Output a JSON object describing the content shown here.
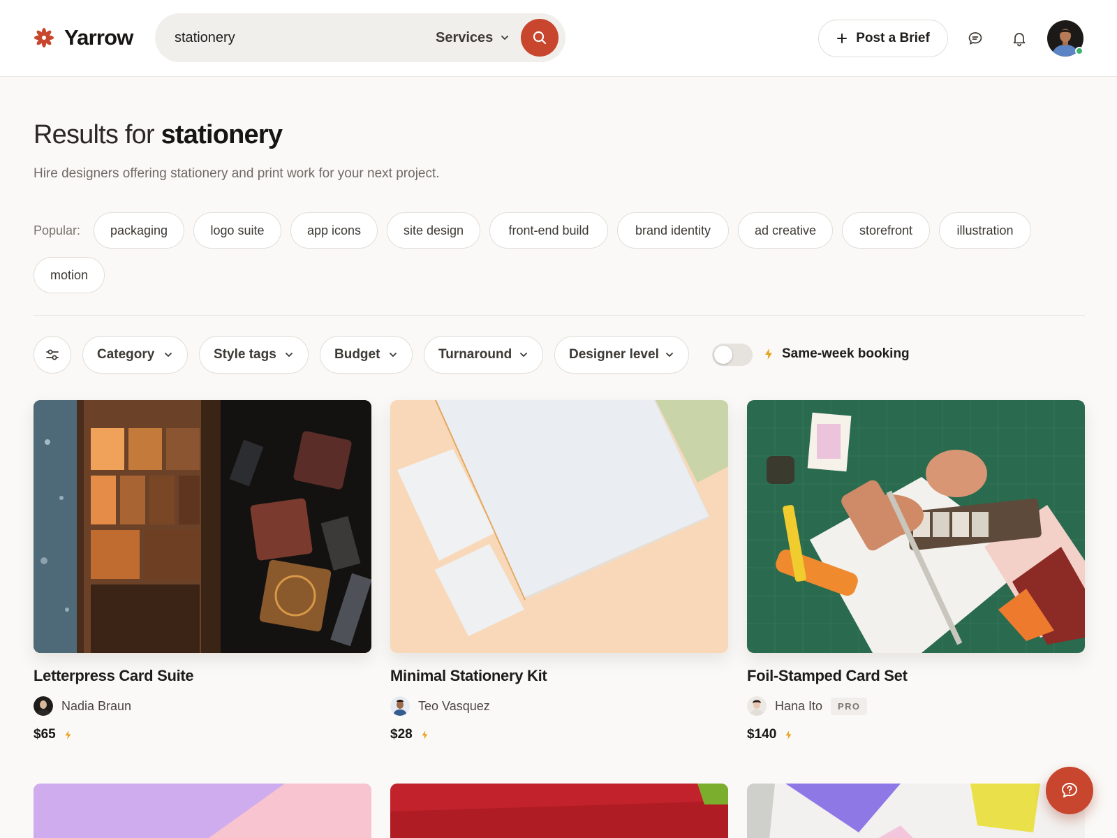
{
  "header": {
    "brand_name": "Yarrow",
    "search_value": "stationery",
    "search_scope": "Services",
    "post_brief_label": "Post a Brief",
    "icons": [
      "search-icon",
      "chat-icon",
      "bell-icon"
    ],
    "accent_color": "#c7462d"
  },
  "page": {
    "title_prefix": "Results for",
    "title_query": "stationery",
    "subtitle": "Hire designers offering stationery and print work for your next project."
  },
  "popular": {
    "label": "Popular:",
    "tags": [
      "packaging",
      "logo suite",
      "app icons",
      "site design",
      "front-end build",
      "brand identity",
      "ad creative",
      "storefront",
      "illustration",
      "motion"
    ]
  },
  "filters": {
    "items": [
      "Category",
      "Style tags",
      "Budget",
      "Turnaround",
      "Designer level"
    ],
    "same_week_label": "Same-week booking",
    "same_week_enabled": false
  },
  "cards": [
    {
      "title": "Letterpress Card Suite",
      "seller": "Nadia Braun",
      "price": "$65",
      "pro": false
    },
    {
      "title": "Minimal Stationery Kit",
      "seller": "Teo Vasquez",
      "price": "$28",
      "pro": false
    },
    {
      "title": "Foil-Stamped Card Set",
      "seller": "Hana Ito",
      "price": "$140",
      "pro": true,
      "badge": "PRO"
    }
  ]
}
